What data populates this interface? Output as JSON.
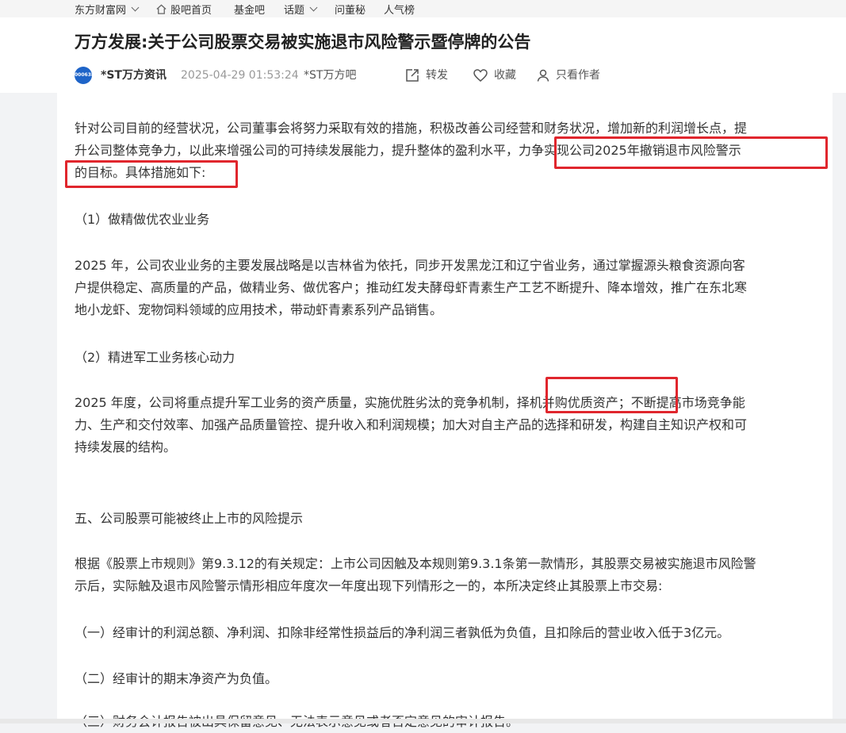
{
  "topnav": {
    "site": "东方财富网",
    "home": "股吧首页",
    "fund": "基金吧",
    "topics": "话题",
    "ask": "问董秘",
    "popular": "人气榜"
  },
  "article": {
    "title": "万方发展:关于公司股票交易被实施退市风险警示暨停牌的公告",
    "avatar_text": "000638",
    "author": "*ST万方资讯",
    "time": "2025-04-29 01:53:24",
    "bar_name": "*ST万方吧",
    "actions": {
      "share": "转发",
      "favorite": "收藏",
      "author_only": "只看作者"
    }
  },
  "content": {
    "p1_line1": "针对公司目前的经营状况，公司董事会将努力采取有效的措施，积极改善公司经营和财务状况，增加新的利润增长点，提",
    "p1_line2": "升公司整体竞争力，以此来增强公司的可持续发展能力，提升整体的盈利水平，力争实现公司2025年撤销退市风险警示",
    "p1_line3": "的目标。具体措施如下:",
    "h1": "（1）做精做优农业业务",
    "p2_line1": "2025 年，公司农业业务的主要发展战略是以吉林省为依托，同步开发黑龙江和辽宁省业务，通过掌握源头粮食资源向客",
    "p2_line2": "户提供稳定、高质量的产品，做精业务、做优客户；推动红发夫酵母虾青素生产工艺不断提升、降本增效，推广在东北寒",
    "p2_line3": "地小龙虾、宠物饲料领域的应用技术，带动虾青素系列产品销售。",
    "h2": "（2）精进军工业务核心动力",
    "p3_line1": "2025 年度，公司将重点提升军工业务的资产质量，实施优胜劣汰的竞争机制，择机并购优质资产；不断提高市场竞争能",
    "p3_line2": "力、生产和交付效率、加强产品质量管控、提升收入和利润规模；加大对自主产品的选择和研发，构建自主知识产权和可",
    "p3_line3": "持续发展的结构。",
    "h3": "五、公司股票可能被终止上市的风险提示",
    "p4_line1": "根据《股票上市规则》第9.3.12的有关规定：上市公司因触及本规则第9.3.1条第一款情形，其股票交易被实施退市风险警",
    "p4_line2": "示后，实际触及退市风险警示情形相应年度次一年度出现下列情形之一的，本所决定终止其股票上市交易:",
    "item1": "（一）经审计的利润总额、净利润、扣除非经常性损益后的净利润三者孰低为负值，且扣除后的营业收入低于3亿元。",
    "item2": "（二）经审计的期末净资产为负值。",
    "item3": "（三）财务会计报告被出具保留意见、无法表示意见或者否定意见的审计报告。"
  },
  "colors": {
    "highlight": "#e0262d",
    "avatar_bg": "#1e64c8"
  }
}
